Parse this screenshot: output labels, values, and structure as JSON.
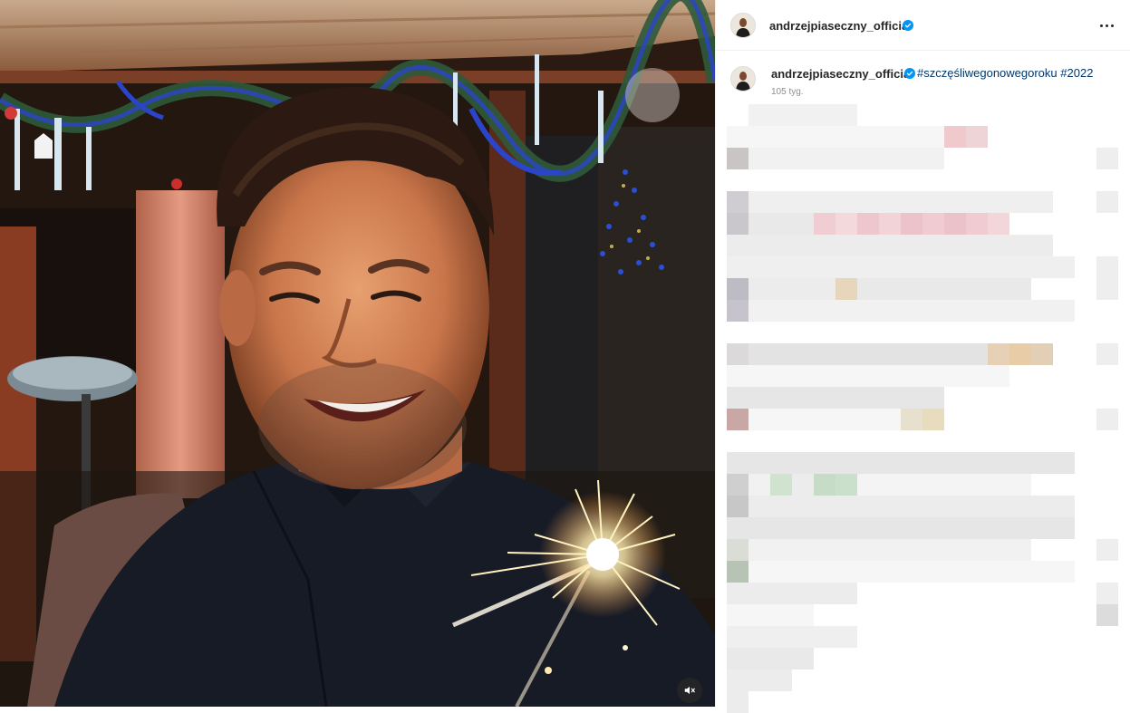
{
  "post": {
    "username": "andrzejpiaseczny_official",
    "caption": {
      "username": "andrzejpiaseczny_official",
      "hashtags": [
        "#szczęśliwegonowegoroku",
        "#2022"
      ],
      "time": "105 tyg."
    }
  },
  "icons": {
    "more": "more-options-icon",
    "verified": "verified-badge-icon",
    "mute": "muted-speaker-icon"
  },
  "colors": {
    "verified": "#0095f6",
    "hashtag": "#00376b",
    "username": "#262626",
    "timestamp": "#8e8e8e"
  }
}
